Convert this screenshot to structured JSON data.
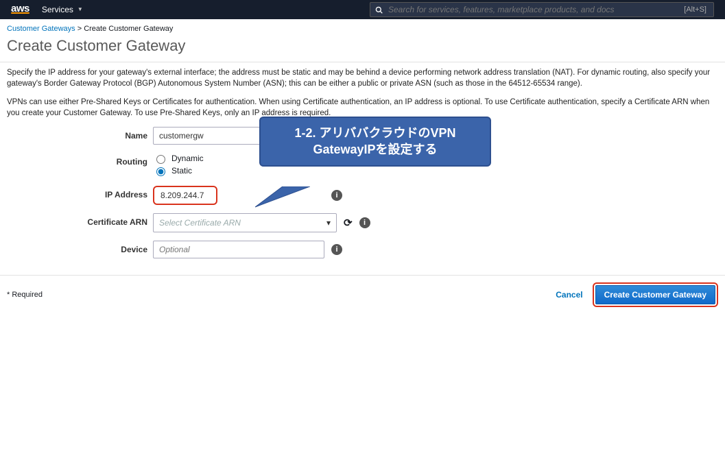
{
  "topnav": {
    "logo_text": "aws",
    "services_label": "Services",
    "search_placeholder": "Search for services, features, marketplace products, and docs",
    "search_shortcut": "[Alt+S]"
  },
  "breadcrumbs": {
    "parent_label": "Customer Gateways",
    "sep": " > ",
    "current": "Create Customer Gateway"
  },
  "page_title": "Create Customer Gateway",
  "paragraph1": "Specify the IP address for your gateway's external interface; the address must be static and may be behind a device performing network address translation (NAT). For dynamic routing, also specify your gateway's Border Gateway Protocol (BGP) Autonomous System Number (ASN); this can be either a public or private ASN (such as those in the 64512-65534 range).",
  "paragraph2": "VPNs can use either Pre-Shared Keys or Certificates for authentication. When using Certificate authentication, an IP address is optional. To use Certificate authentication, specify a Certificate ARN when you create your Customer Gateway. To use Pre-Shared Keys, only an IP address is required.",
  "form": {
    "name_label": "Name",
    "name_value": "customergw",
    "routing_label": "Routing",
    "routing_options": {
      "dynamic": "Dynamic",
      "static": "Static"
    },
    "routing_selected": "static",
    "ip_label": "IP Address",
    "ip_value": "8.209.244.7",
    "cert_label": "Certificate ARN",
    "cert_placeholder": "Select Certificate ARN",
    "device_label": "Device",
    "device_placeholder": "Optional"
  },
  "footer": {
    "required_label": "* Required",
    "cancel_label": "Cancel",
    "create_label": "Create Customer Gateway"
  },
  "callout": {
    "text": "1-2. アリババクラウドのVPN GatewayIPを設定する"
  },
  "colors": {
    "link": "#0073bb",
    "primary_button": "#1069c9",
    "callout_bg": "#3b64aa",
    "highlight_border": "#d9321c"
  }
}
